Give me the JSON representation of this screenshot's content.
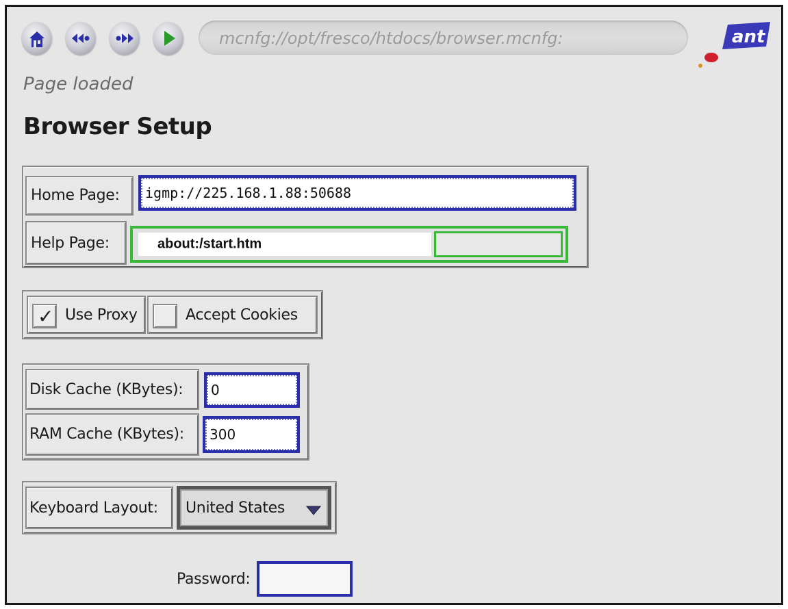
{
  "toolbar": {
    "home_icon": "home-icon",
    "back_icon": "back-icon",
    "forward_icon": "forward-icon",
    "go_icon": "play-icon",
    "url": "mcnfg://opt/fresco/htdocs/browser.mcnfg:",
    "logo_text": "ant"
  },
  "status": "Page loaded",
  "page_title": "Browser Setup",
  "form": {
    "home_page": {
      "label": "Home Page:",
      "value": "igmp://225.168.1.88:50688"
    },
    "help_page": {
      "label": "Help Page:",
      "value": "about:/start.htm",
      "extra_value": ""
    },
    "use_proxy": {
      "label": "Use Proxy",
      "checked": true,
      "mark": "✓"
    },
    "accept_cookies": {
      "label": "Accept Cookies",
      "checked": false
    },
    "disk_cache": {
      "label": "Disk Cache (KBytes):",
      "value": "0"
    },
    "ram_cache": {
      "label": "RAM Cache (KBytes):",
      "value": "300"
    },
    "keyboard_layout": {
      "label": "Keyboard Layout:",
      "value": "United States"
    },
    "password": {
      "label": "Password:",
      "value": ""
    }
  },
  "colors": {
    "focus_blue": "#2a2ea8",
    "focus_green": "#37b837",
    "logo_blue": "#3a3ab8",
    "logo_red": "#d02030"
  }
}
